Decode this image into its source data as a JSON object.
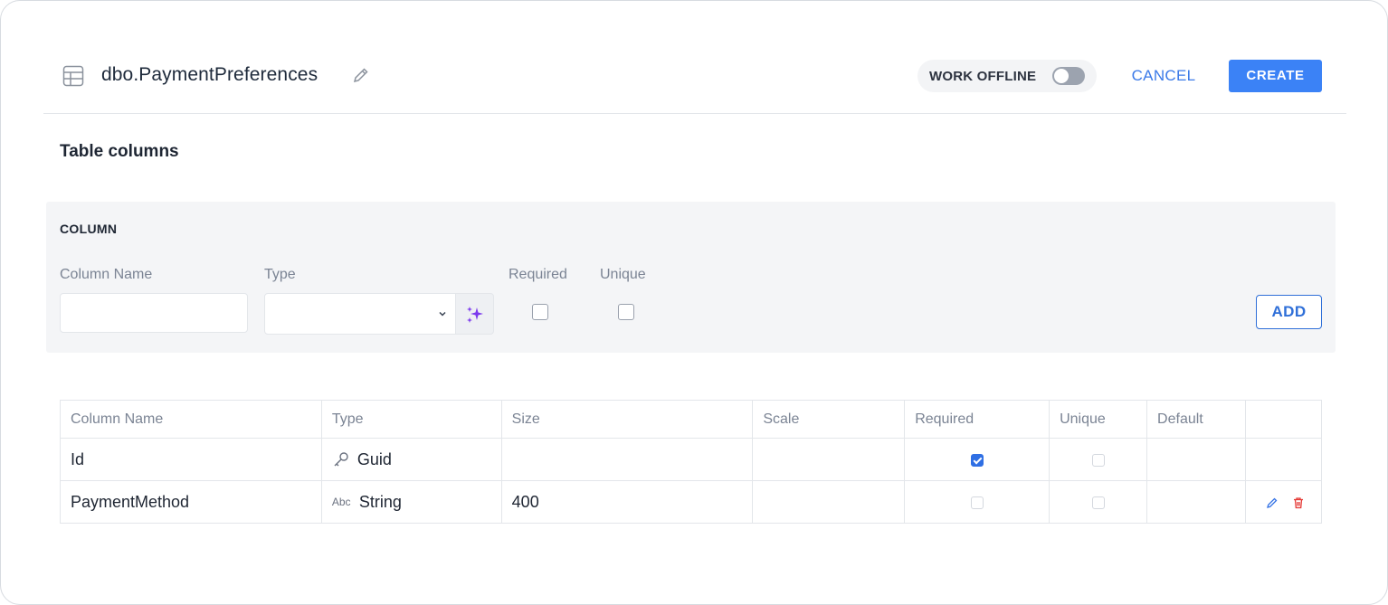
{
  "header": {
    "title": "dbo.PaymentPreferences",
    "work_offline_label": "WORK OFFLINE",
    "work_offline_on": false,
    "cancel_label": "CANCEL",
    "create_label": "CREATE"
  },
  "section_title": "Table columns",
  "form": {
    "heading": "COLUMN",
    "column_name_label": "Column Name",
    "column_name_value": "",
    "type_label": "Type",
    "type_value": "",
    "required_label": "Required",
    "required_checked": false,
    "unique_label": "Unique",
    "unique_checked": false,
    "add_label": "ADD"
  },
  "table": {
    "headers": [
      "Column Name",
      "Type",
      "Size",
      "Scale",
      "Required",
      "Unique",
      "Default",
      ""
    ],
    "rows": [
      {
        "name": "Id",
        "type_icon": "key-icon",
        "type": "Guid",
        "size": "",
        "scale": "",
        "required": true,
        "unique": false,
        "default": ""
      },
      {
        "name": "PaymentMethod",
        "type_icon": "abc-icon",
        "type_icon_text": "Abc",
        "type": "String",
        "size": "400",
        "scale": "",
        "required": false,
        "unique": false,
        "default": ""
      }
    ]
  },
  "colors": {
    "accent": "#3b82f6",
    "delete": "#e53935",
    "magic": "#7c3aed"
  }
}
